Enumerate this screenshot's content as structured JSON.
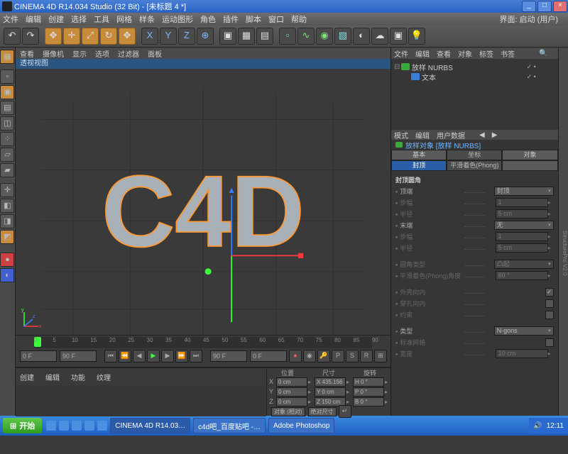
{
  "title": "CINEMA 4D R14.034 Studio (32 Bit) - [未标题 4 *]",
  "menu": [
    "文件",
    "编辑",
    "创建",
    "选择",
    "工具",
    "网格",
    "样条",
    "运动图形",
    "角色",
    "插件",
    "脚本",
    "窗口",
    "帮助"
  ],
  "menu_right": "界面:  启动 (用户)",
  "vp_menu": [
    "查看",
    "摄像机",
    "显示",
    "选项",
    "过滤器",
    "面板"
  ],
  "vp_label": "透视视图",
  "vp_text": "C4D",
  "timeline": {
    "start": "0 F",
    "end_vis": "90 F",
    "end": "90 F",
    "start2": "0 F",
    "ticks": [
      0,
      5,
      10,
      15,
      20,
      25,
      30,
      35,
      40,
      45,
      50,
      55,
      60,
      65,
      70,
      75,
      80,
      85,
      90
    ]
  },
  "bottom_tabs": [
    "创建",
    "编辑",
    "功能",
    "纹理"
  ],
  "coords": {
    "head": [
      "位置",
      "尺寸",
      "旋转"
    ],
    "rows": [
      {
        "a": "X",
        "p": "0 cm",
        "s": "X 435.156 cm",
        "r": "H 0 °"
      },
      {
        "a": "Y",
        "p": "0 cm",
        "s": "Y 0 cm",
        "r": "P 0 °"
      },
      {
        "a": "Z",
        "p": "0 cm",
        "s": "Z 150 cm",
        "r": "B 0 °"
      }
    ],
    "foot": [
      "对象 (相对)",
      "绝对尺寸"
    ]
  },
  "obj_tabs": [
    "文件",
    "编辑",
    "查看",
    "对象",
    "标签",
    "书签"
  ],
  "hier": [
    {
      "exp": "⊟",
      "ico": "nurbs",
      "name": "放样 NURBS",
      "dots": "✓ •"
    },
    {
      "exp": "",
      "ico": "text",
      "name": "文本",
      "dots": "✓ •",
      "indent": 14
    }
  ],
  "attr_tabs": [
    "模式",
    "编辑",
    "用户数据"
  ],
  "attr_head": "放样对象  [放样 NURBS]",
  "subtabs": [
    {
      "t": "基本",
      "c": "st-a"
    },
    {
      "t": "坐标",
      "c": "st-b"
    },
    {
      "t": "对象",
      "c": "st-a"
    },
    {
      "t": "封顶",
      "c": "st-sel"
    },
    {
      "t": "平滑着色(Phong)",
      "c": "st-b"
    },
    {
      "t": "",
      "c": "st-a"
    }
  ],
  "attr_section": "封顶圆角",
  "attrs": [
    {
      "lbl": "顶端",
      "type": "dd",
      "val": "封顶"
    },
    {
      "lbl": "步幅",
      "type": "fld",
      "val": "1",
      "dim": true
    },
    {
      "lbl": "半径",
      "type": "fld",
      "val": "5 cm",
      "dim": true
    },
    {
      "lbl": "末端",
      "type": "dd",
      "val": "无"
    },
    {
      "lbl": "步幅",
      "type": "fld",
      "val": "1",
      "dim": true
    },
    {
      "lbl": "半径",
      "type": "fld",
      "val": "5 cm",
      "dim": true
    },
    {
      "sep": true
    },
    {
      "lbl": "圆角类型",
      "type": "dd",
      "val": "凸起",
      "dim": true
    },
    {
      "lbl": "平滑着色(Phong)角度",
      "type": "fld",
      "val": "60 °",
      "dim": true
    },
    {
      "sep": true
    },
    {
      "lbl": "外壳向内",
      "type": "chk",
      "val": "✓",
      "dim": true
    },
    {
      "lbl": "穿孔向内",
      "type": "chk",
      "val": "",
      "dim": true
    },
    {
      "lbl": "约束",
      "type": "chk",
      "val": "",
      "dim": true
    },
    {
      "sep": true
    },
    {
      "lbl": "类型",
      "type": "dd",
      "val": "N-gons"
    },
    {
      "lbl": "标准网格",
      "type": "chk",
      "val": "",
      "dim": true
    },
    {
      "lbl": "宽度",
      "type": "fld",
      "val": "10 cm",
      "dim": true
    }
  ],
  "taskbar": {
    "start": "开始",
    "tasks": [
      {
        "t": "CINEMA 4D R14.03…",
        "a": true
      },
      {
        "t": "c4d吧_百度贴吧 -…"
      },
      {
        "t": "Adobe Photoshop"
      }
    ],
    "time": "12:11"
  }
}
